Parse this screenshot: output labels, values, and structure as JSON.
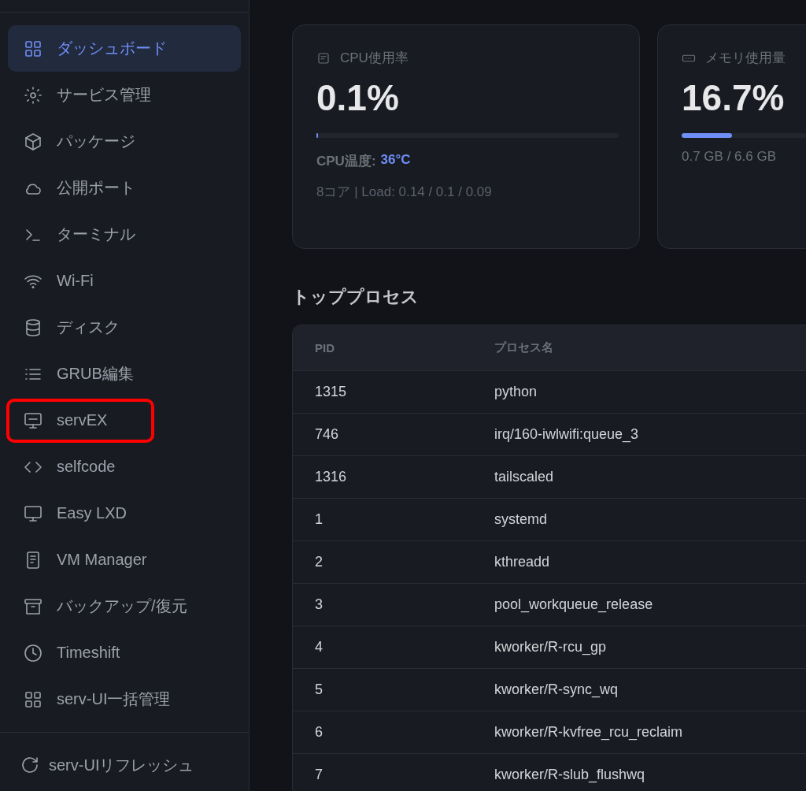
{
  "sidebar": {
    "items": [
      {
        "label": "ダッシュボード",
        "selected": true,
        "annotated": false
      },
      {
        "label": "サービス管理",
        "selected": false,
        "annotated": false
      },
      {
        "label": "パッケージ",
        "selected": false,
        "annotated": false
      },
      {
        "label": "公開ポート",
        "selected": false,
        "annotated": false
      },
      {
        "label": "ターミナル",
        "selected": false,
        "annotated": false
      },
      {
        "label": "Wi-Fi",
        "selected": false,
        "annotated": false
      },
      {
        "label": "ディスク",
        "selected": false,
        "annotated": false
      },
      {
        "label": "GRUB編集",
        "selected": false,
        "annotated": false
      },
      {
        "label": "servEX",
        "selected": false,
        "annotated": true
      },
      {
        "label": "selfcode",
        "selected": false,
        "annotated": false
      },
      {
        "label": "Easy LXD",
        "selected": false,
        "annotated": false
      },
      {
        "label": "VM Manager",
        "selected": false,
        "annotated": false
      },
      {
        "label": "バックアップ/復元",
        "selected": false,
        "annotated": false
      },
      {
        "label": "Timeshift",
        "selected": false,
        "annotated": false
      },
      {
        "label": "serv-UI一括管理",
        "selected": false,
        "annotated": false
      }
    ],
    "footer": {
      "label": "serv-UIリフレッシュ"
    }
  },
  "cards": [
    {
      "title": "CPU使用率",
      "value": "0.1%",
      "level": 0.002,
      "temp_label": "CPU温度:",
      "temp_value": "36°C",
      "detail": "8コア | Load: 0.14 / 0.1 / 0.09"
    },
    {
      "title": "メモリ使用量",
      "value": "16.7%",
      "level": 0.167,
      "detail": "0.7 GB / 6.6 GB"
    }
  ],
  "processes": {
    "title": "トッププロセス",
    "columns": [
      "PID",
      "プロセス名"
    ],
    "rows": [
      [
        "1315",
        "python"
      ],
      [
        "746",
        "irq/160-iwlwifi:queue_3"
      ],
      [
        "1316",
        "tailscaled"
      ],
      [
        "1",
        "systemd"
      ],
      [
        "2",
        "kthreadd"
      ],
      [
        "3",
        "pool_workqueue_release"
      ],
      [
        "4",
        "kworker/R-rcu_gp"
      ],
      [
        "5",
        "kworker/R-sync_wq"
      ],
      [
        "6",
        "kworker/R-kvfree_rcu_reclaim"
      ],
      [
        "7",
        "kworker/R-slub_flushwq"
      ]
    ]
  }
}
